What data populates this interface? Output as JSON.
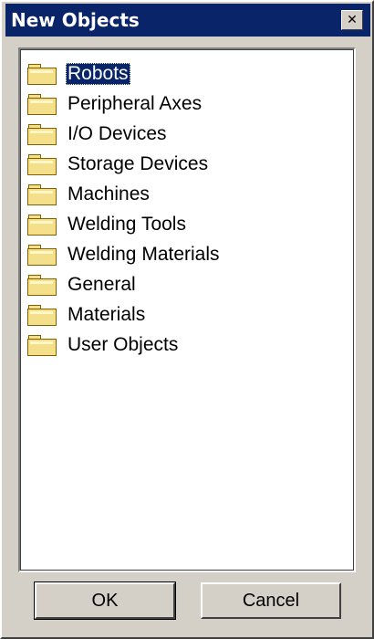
{
  "window": {
    "title": "New Objects",
    "close_glyph": "✕"
  },
  "tree": {
    "items": [
      {
        "label": "Robots",
        "icon": "folder-icon",
        "selected": true
      },
      {
        "label": "Peripheral Axes",
        "icon": "folder-icon",
        "selected": false
      },
      {
        "label": "I/O Devices",
        "icon": "folder-icon",
        "selected": false
      },
      {
        "label": "Storage Devices",
        "icon": "folder-icon",
        "selected": false
      },
      {
        "label": "Machines",
        "icon": "folder-icon",
        "selected": false
      },
      {
        "label": "Welding Tools",
        "icon": "folder-icon",
        "selected": false
      },
      {
        "label": "Welding Materials",
        "icon": "folder-icon",
        "selected": false
      },
      {
        "label": "General",
        "icon": "folder-icon",
        "selected": false
      },
      {
        "label": "Materials",
        "icon": "folder-icon",
        "selected": false
      },
      {
        "label": "User Objects",
        "icon": "folder-icon",
        "selected": false
      }
    ]
  },
  "buttons": {
    "ok_label": "OK",
    "cancel_label": "Cancel"
  },
  "colors": {
    "titlebar": "#0a246a",
    "face": "#d4d0c8",
    "selection": "#0a246a",
    "folder": "#f4e08a"
  }
}
